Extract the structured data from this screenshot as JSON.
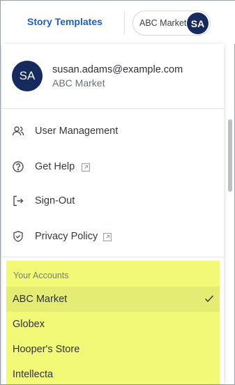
{
  "header": {
    "story_templates": "Story Templates",
    "account_pill_label": "ABC Market",
    "avatar_initials": "SA"
  },
  "profile": {
    "avatar_initials": "SA",
    "email": "susan.adams@example.com",
    "organization": "ABC Market"
  },
  "menu": {
    "items": [
      {
        "label": "User Management",
        "icon": "users-icon"
      },
      {
        "label": "Get Help",
        "icon": "help-icon",
        "external": true
      },
      {
        "label": "Sign-Out",
        "icon": "sign-out-icon"
      },
      {
        "label": "Privacy Policy",
        "icon": "shield-icon",
        "external": true
      }
    ]
  },
  "accounts": {
    "heading": "Your Accounts",
    "items": [
      {
        "label": "ABC Market",
        "selected": true
      },
      {
        "label": "Globex",
        "selected": false
      },
      {
        "label": "Hooper's Store",
        "selected": false
      },
      {
        "label": "Intellecta",
        "selected": false
      }
    ]
  },
  "colors": {
    "link_blue": "#1f5fbf",
    "avatar_navy": "#172a5e",
    "highlight_yellow": "#f2f977"
  }
}
